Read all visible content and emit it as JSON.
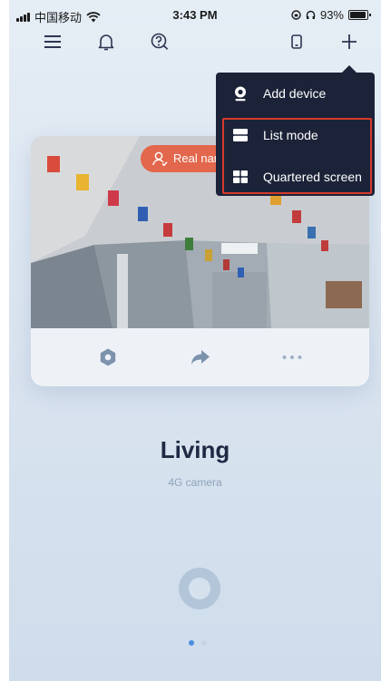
{
  "status_bar": {
    "carrier": "中国移动",
    "time": "3:43 PM",
    "battery": "93%",
    "battery_level": 0.93
  },
  "toolbar": {
    "icons": [
      "menu-icon",
      "bell-icon",
      "help-icon",
      "device-icon",
      "plus-icon"
    ]
  },
  "menu": {
    "items": [
      {
        "label": "Add device",
        "icon": "camera-icon"
      },
      {
        "label": "List mode",
        "icon": "list-icon"
      },
      {
        "label": "Quartered screen",
        "icon": "grid-icon"
      }
    ],
    "highlight_color": "#d63a2c",
    "background": "#1c2338"
  },
  "camera_card": {
    "badge_label": "Real nar",
    "badge_color": "#e2674c",
    "actions": [
      "settings-icon",
      "share-icon",
      "more-icon"
    ]
  },
  "device": {
    "name": "Living",
    "type": "4G camera"
  },
  "pagination": {
    "count": 2,
    "active_index": 0,
    "active_color": "#4a8fe0"
  }
}
